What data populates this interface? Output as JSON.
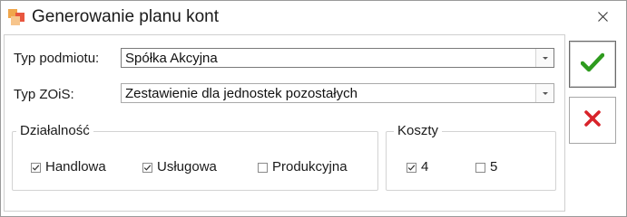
{
  "window": {
    "title": "Generowanie planu kont"
  },
  "form": {
    "typ_podmiotu": {
      "label": "Typ podmiotu:",
      "value": "Spółka Akcyjna"
    },
    "typ_zois": {
      "label": "Typ ZOiS:",
      "value": "Zestawienie dla jednostek pozostałych"
    }
  },
  "dzialalnosc": {
    "legend": "Działalność",
    "items": [
      {
        "label": "Handlowa",
        "checked": true
      },
      {
        "label": "Usługowa",
        "checked": true
      },
      {
        "label": "Produkcyjna",
        "checked": false
      }
    ]
  },
  "koszty": {
    "legend": "Koszty",
    "items": [
      {
        "label": "4",
        "checked": true
      },
      {
        "label": "5",
        "checked": false
      }
    ]
  },
  "colors": {
    "confirm": "#2e9b1e",
    "cancel": "#d8232a"
  },
  "icons": {
    "confirm": "checkmark-icon",
    "cancel": "x-icon",
    "close": "close-icon"
  }
}
